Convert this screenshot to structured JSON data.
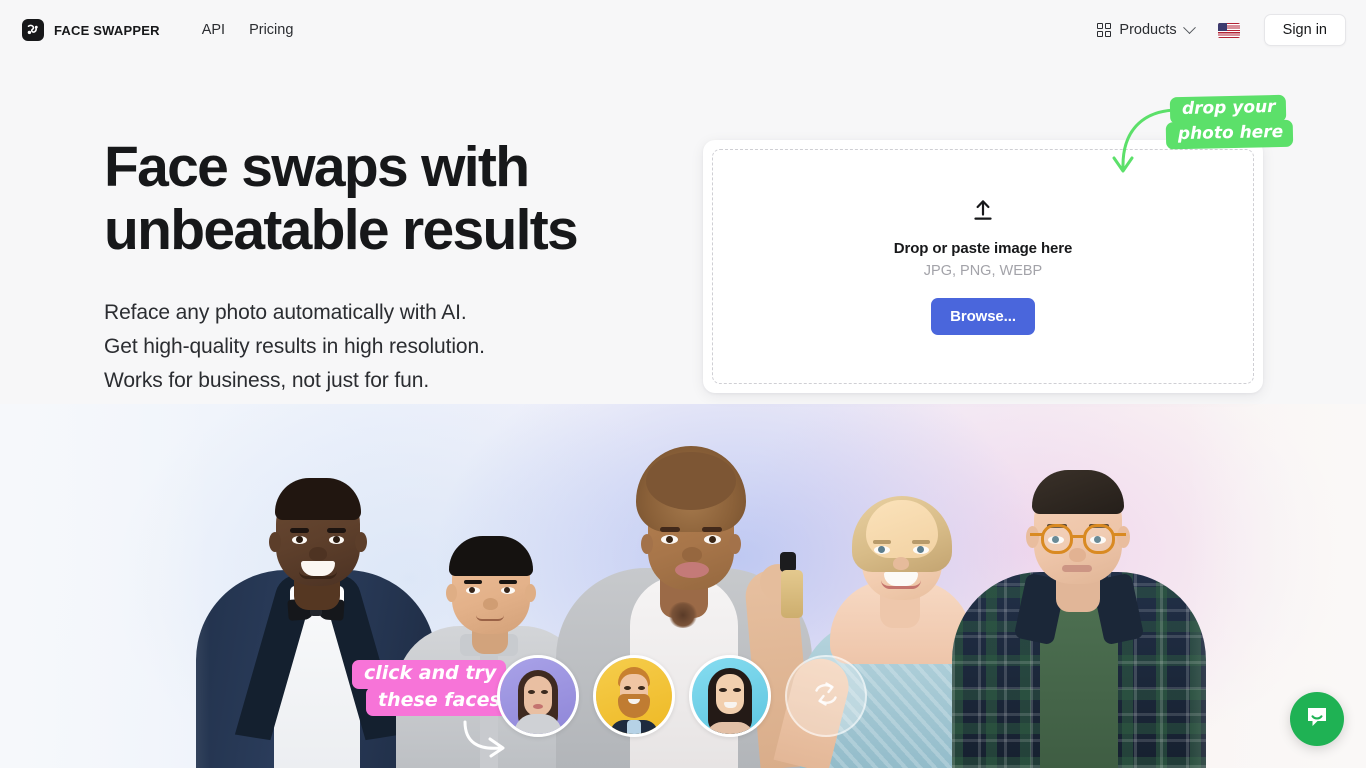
{
  "nav": {
    "brand": "FACE SWAPPER",
    "brand_icon": "face-swap-logo-icon",
    "links": [
      {
        "label": "API"
      },
      {
        "label": "Pricing"
      }
    ],
    "products": {
      "label": "Products",
      "grid_icon": "grid-icon",
      "chevron_icon": "chevron-down-icon"
    },
    "language_flag": "us-flag-icon",
    "signin_label": "Sign in"
  },
  "hero": {
    "headline": "Face swaps with\nunbeatable results",
    "subhead": "Reface any photo automatically with AI.\nGet high-quality results in high resolution.\nWorks for business, not just for fun."
  },
  "upload": {
    "icon": "upload-arrow-icon",
    "title": "Drop or paste image here",
    "formats": "JPG, PNG, WEBP",
    "browse_label": "Browse..."
  },
  "annotations": {
    "green": {
      "line1": "drop your",
      "line2": "photo here",
      "color": "#5ce06a",
      "arrow": "curved-down-arrow-icon"
    },
    "pink": {
      "line1": "click and try",
      "line2": "these faces",
      "color": "#f774d8",
      "arrow": "curved-right-arrow-icon"
    }
  },
  "face_picker": {
    "thumbs": [
      {
        "name": "face-option-1",
        "bg": "#9b94e0",
        "skin": "#e8bfa5",
        "hair": "#4b3125"
      },
      {
        "name": "face-option-2",
        "bg": "#f2c43c",
        "skin": "#efc5a6",
        "hair": "#c47a35"
      },
      {
        "name": "face-option-3",
        "bg": "#74d3ea",
        "skin": "#f0cdae",
        "hair": "#2d1f1a"
      }
    ],
    "shuffle_icon": "shuffle-refresh-icon"
  },
  "hero_photo": {
    "people": [
      {
        "name": "man-in-tuxedo",
        "skin": "#60412d",
        "garment": "#273a57",
        "hair": "#2b1d16"
      },
      {
        "name": "boy-in-grey-shirt",
        "skin": "#e0b087",
        "garment": "#c9cbce",
        "hair": "#16130f"
      },
      {
        "name": "woman-with-perfume",
        "skin": "#a9754f",
        "garment": "#bfc2c6",
        "hair": "#8c6240"
      },
      {
        "name": "blonde-woman-in-blue-dress",
        "skin": "#f0cfb6",
        "garment": "#a9ccd8",
        "hair": "#d9c295"
      },
      {
        "name": "man-with-glasses-plaid-shirt",
        "skin": "#eccbb4",
        "garment": "#1d2a3d",
        "hair": "#26211c"
      }
    ]
  },
  "chat": {
    "icon": "intercom-chat-icon",
    "color": "#1fb254"
  }
}
